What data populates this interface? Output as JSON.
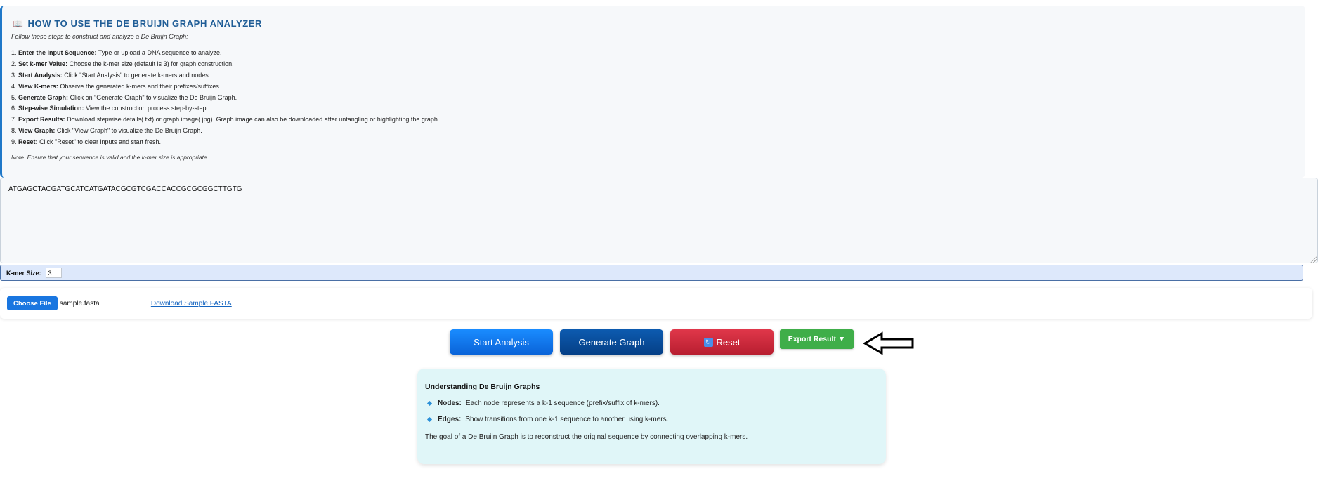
{
  "howto": {
    "title": "HOW TO USE THE DE BRUIJN GRAPH ANALYZER",
    "subtitle": "Follow these steps to construct and analyze a De Bruijn Graph:",
    "steps": [
      {
        "label": "Enter the Input Sequence:",
        "text": "Type or upload a DNA sequence to analyze."
      },
      {
        "label": "Set k-mer Value:",
        "text": "Choose the k-mer size (default is 3) for graph construction."
      },
      {
        "label": "Start Analysis:",
        "text": "Click \"Start Analysis\" to generate k-mers and nodes."
      },
      {
        "label": "View K-mers:",
        "text": "Observe the generated k-mers and their prefixes/suffixes."
      },
      {
        "label": "Generate Graph:",
        "text": "Click on \"Generate Graph\" to visualize the De Bruijn Graph."
      },
      {
        "label": "Step-wise Simulation:",
        "text": "View the construction process step-by-step."
      },
      {
        "label": "Export Results:",
        "text": "Download stepwise details(.txt) or graph image(.jpg). Graph image can also be downloaded after untangling or highlighting the graph."
      },
      {
        "label": "View Graph:",
        "text": "Click \"View Graph\" to visualize the De Bruijn Graph."
      },
      {
        "label": "Reset:",
        "text": "Click \"Reset\" to clear inputs and start fresh."
      }
    ],
    "step_numbers": [
      "1.",
      "2.",
      "3.",
      "4.",
      "5.",
      "6.",
      "7.",
      "8.",
      "9."
    ],
    "note": "Note: Ensure that your sequence is valid and the k-mer size is appropriate."
  },
  "sequence": {
    "value": "ATGAGCTACGATGCATCATGATACGCGTCGACCACCGCGCGGCTTGTG"
  },
  "kmer": {
    "label": "K-mer Size:",
    "value": "3"
  },
  "file": {
    "choose_label": "Choose File",
    "file_name": "sample.fasta",
    "download_link": "Download Sample FASTA"
  },
  "actions": {
    "start_label": "Start Analysis",
    "graph_label": "Generate Graph",
    "reset_label": "Reset",
    "export_label": "Export Result ▼"
  },
  "info": {
    "title": "Understanding De Bruijn Graphs",
    "items": [
      {
        "label": "Nodes:",
        "text": "Each node represents a k-1 sequence (prefix/suffix of k-mers)."
      },
      {
        "label": "Edges:",
        "text": "Show transitions from one k-1 sequence to another using k-mers."
      }
    ],
    "goal": "The goal of a De Bruijn Graph is to reconstruct the original sequence by connecting overlapping k-mers."
  },
  "icons": {
    "book": "book-icon",
    "reset": "reset-icon",
    "arrow": "left-arrow-icon",
    "bullet": "diamond-icon"
  },
  "colors": {
    "primary": "#1a8cff",
    "graph": "#053f86",
    "reset": "#d22c3e",
    "export": "#3fae49",
    "title": "#1f5d96"
  }
}
